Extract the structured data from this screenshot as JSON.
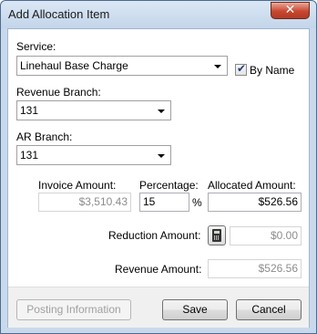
{
  "window": {
    "title": "Add Allocation Item",
    "close_glyph": "✕"
  },
  "service": {
    "label": "Service:",
    "value": "Linehaul Base Charge",
    "by_name_label": "By Name",
    "by_name_checked": true,
    "check_glyph": "✔"
  },
  "revenue_branch": {
    "label": "Revenue Branch:",
    "value": "131"
  },
  "ar_branch": {
    "label": "AR Branch:",
    "value": "131"
  },
  "amounts": {
    "invoice_label": "Invoice Amount:",
    "invoice_value": "$3,510.43",
    "percentage_label": "Percentage:",
    "percentage_value": "15",
    "percent_sign": "%",
    "allocated_label": "Allocated Amount:",
    "allocated_value": "$526.56",
    "reduction_label": "Reduction Amount:",
    "reduction_value": "$0.00",
    "revenue_label": "Revenue Amount:",
    "revenue_value": "$526.56"
  },
  "footer": {
    "posting_label": "Posting Information",
    "save_label": "Save",
    "cancel_label": "Cancel"
  }
}
